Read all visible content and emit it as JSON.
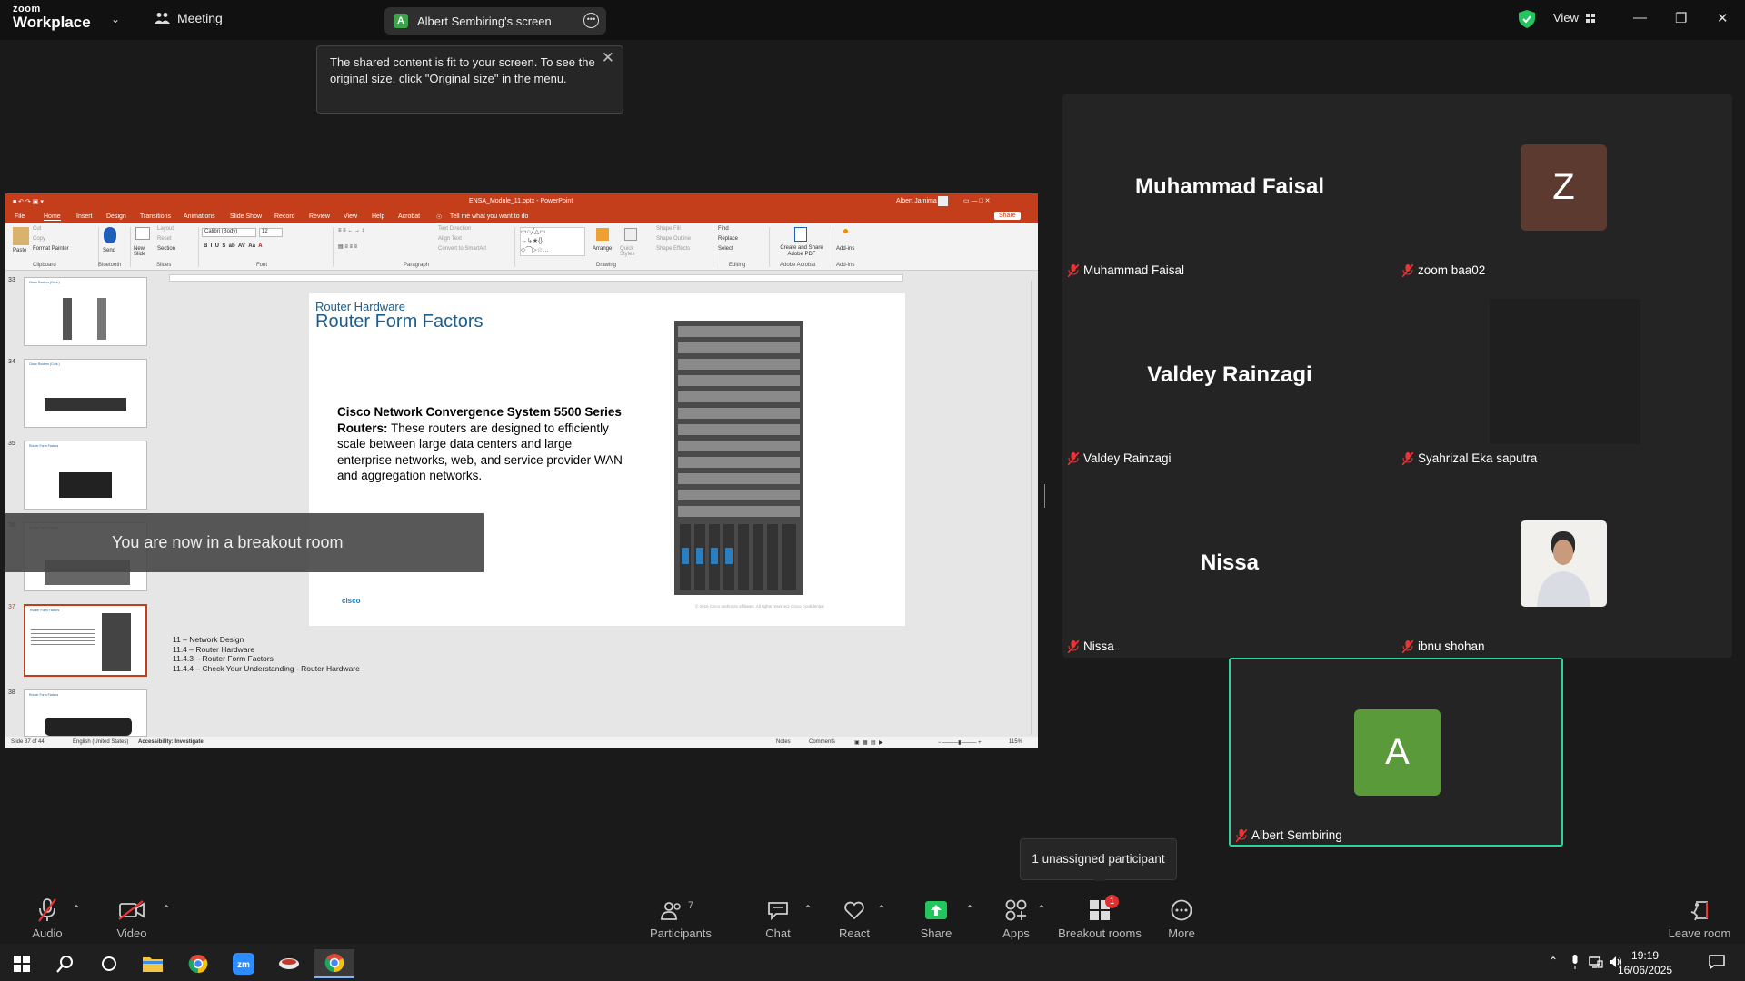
{
  "topbar": {
    "logo_line1": "zoom",
    "logo_line2": "Workplace",
    "meeting_label": "Meeting",
    "screen_tab_badge": "A",
    "screen_tab_label": "Albert Sembiring's screen",
    "view_label": "View"
  },
  "fit_tip": {
    "text": "The shared content is fit to your screen. To see the original size, click \"Original size\" in the menu."
  },
  "ppt": {
    "window_title": "ENSA_Module_11.pptx - PowerPoint",
    "user": "Albert Jamima",
    "share": "Share",
    "tabs": [
      "File",
      "Home",
      "Insert",
      "Design",
      "Transitions",
      "Animations",
      "Slide Show",
      "Record",
      "Review",
      "View",
      "Help",
      "Acrobat"
    ],
    "tell_me": "Tell me what you want to do",
    "ribbon": {
      "paste": "Paste",
      "cut": "Cut",
      "copy": "Copy",
      "format_painter": "Format Painter",
      "send": "Send",
      "new_slide": "New Slide",
      "layout": "Layout",
      "reset": "Reset",
      "section": "Section",
      "font_name": "Calibri (Body)",
      "font_size": "12",
      "text_direction": "Text Direction",
      "align_text": "Align Text",
      "convert_smartart": "Convert to SmartArt",
      "arrange": "Arrange",
      "quick_styles": "Quick Styles",
      "shape_fill": "Shape Fill",
      "shape_outline": "Shape Outline",
      "shape_effects": "Shape Effects",
      "find": "Find",
      "replace": "Replace",
      "select": "Select",
      "create_share_pdf": "Create and Share Adobe PDF",
      "add_ins": "Add-ins",
      "groups": [
        "Clipboard",
        "Bluetooth",
        "Slides",
        "Font",
        "Paragraph",
        "Drawing",
        "Editing",
        "Adobe Acrobat",
        "Add-ins"
      ]
    },
    "thumbs": [
      {
        "num": "33",
        "title": "Cisco Routers (Cont.)"
      },
      {
        "num": "34",
        "title": "Cisco Routers (Cont.)"
      },
      {
        "num": "35",
        "title": "Router Form Factors"
      },
      {
        "num": "36",
        "title": "Router Form Factors"
      },
      {
        "num": "37",
        "title": "Router Form Factors"
      },
      {
        "num": "38",
        "title": "Router Form Factors"
      }
    ],
    "slide": {
      "subtitle": "Router Hardware",
      "title": "Router Form Factors",
      "body_bold": "Cisco Network Convergence System 5500 Series Routers:",
      "body_rest": " These routers are designed to efficiently scale between large data centers and large enterprise networks, web, and service provider WAN and aggregation networks.",
      "logo": "cisco",
      "copyright": "© 2016 Cisco and/or its affiliates. All rights reserved. Cisco Confidential"
    },
    "notes": [
      "11 – Network Design",
      "11.4 – Router Hardware",
      "11.4.3 – Router Form Factors",
      "11.4.4 – Check Your Understanding - Router Hardware"
    ],
    "status": {
      "slide": "Slide 37 of 44",
      "language": "English (United States)",
      "accessibility": "Accessibility: Investigate",
      "notes": "Notes",
      "comments": "Comments",
      "zoom": "115%"
    }
  },
  "breakout_toast": "You are now in a breakout room",
  "participants": [
    {
      "display": "Muhammad Faisal",
      "label": "Muhammad Faisal"
    },
    {
      "display": "Z",
      "label": "zoom baa02",
      "color": "#5c3a30"
    },
    {
      "display": "Valdey Rainzagi",
      "label": "Valdey Rainzagi"
    },
    {
      "display": "",
      "label": "Syahrizal Eka saputra"
    },
    {
      "display": "Nissa",
      "label": "Nissa"
    },
    {
      "display": "",
      "label": "ibnu shohan"
    },
    {
      "display": "A",
      "label": "Albert Sembiring",
      "color": "#5b9a3b"
    }
  ],
  "unassigned_tip": "1 unassigned participant",
  "toolbar": {
    "audio": "Audio",
    "video": "Video",
    "participants": "Participants",
    "participants_count": "7",
    "chat": "Chat",
    "react": "React",
    "share": "Share",
    "apps": "Apps",
    "breakout": "Breakout rooms",
    "breakout_badge": "1",
    "more": "More",
    "leave": "Leave room"
  },
  "taskbar": {
    "time": "19:19",
    "date": "16/06/2025"
  },
  "colors": {
    "ppt_accent": "#c43e1c",
    "active_speaker": "#2bd49a",
    "share_green": "#22c55e",
    "badge_red": "#e02f2f"
  }
}
